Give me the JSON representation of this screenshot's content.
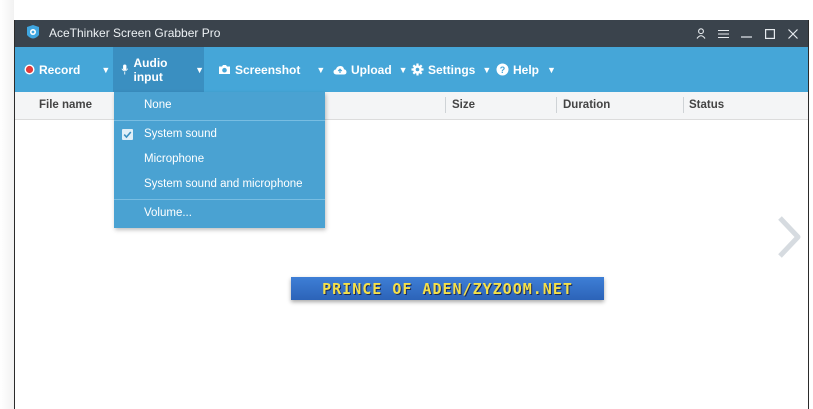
{
  "window": {
    "title": "AceThinker Screen Grabber Pro",
    "controls": [
      "user-icon",
      "menu-icon",
      "minimize-icon",
      "maximize-icon",
      "close-icon"
    ]
  },
  "toolbar": {
    "record": {
      "label": "Record",
      "icon": "record-dot-icon"
    },
    "audio": {
      "label": "Audio input",
      "icon": "microphone-icon"
    },
    "screenshot": {
      "label": "Screenshot",
      "icon": "camera-icon"
    },
    "upload": {
      "label": "Upload",
      "icon": "cloud-upload-icon"
    },
    "settings": {
      "label": "Settings",
      "icon": "gear-icon"
    },
    "help": {
      "label": "Help",
      "icon": "question-icon"
    }
  },
  "table": {
    "columns": [
      "File name",
      "Size",
      "Duration",
      "Status"
    ]
  },
  "audio_menu": {
    "items": [
      {
        "label": "None",
        "checked": false
      },
      {
        "label": "System sound",
        "checked": true
      },
      {
        "label": "Microphone",
        "checked": false
      },
      {
        "label": "System sound and microphone",
        "checked": false
      },
      {
        "label": "Volume...",
        "checked": false
      }
    ]
  },
  "banner": {
    "text": "PRINCE OF ADEN/ZYZOOM.NET"
  },
  "colors": {
    "titlebar": "#3a434c",
    "toolbar": "#45a6d8",
    "menu": "#4aa2d2",
    "record_red": "#e23b3b"
  }
}
